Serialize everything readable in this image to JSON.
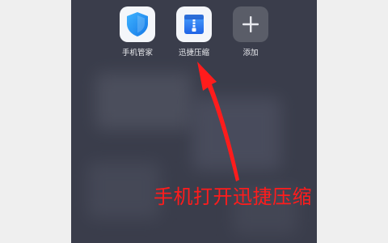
{
  "home_screen": {
    "apps": [
      {
        "label": "手机管家",
        "icon": "shield-icon"
      },
      {
        "label": "迅捷压缩",
        "icon": "zip-archive-icon"
      },
      {
        "label": "添加",
        "icon": "plus-icon"
      }
    ]
  },
  "annotation": {
    "text": "手机打开迅捷压缩",
    "color": "#ff1c1c"
  },
  "colors": {
    "screen_background": "#3a3d4b",
    "shield_blue": "#1f8ef1",
    "zip_blue": "#2f7cf6",
    "arrow_red": "#ff1c1c"
  }
}
